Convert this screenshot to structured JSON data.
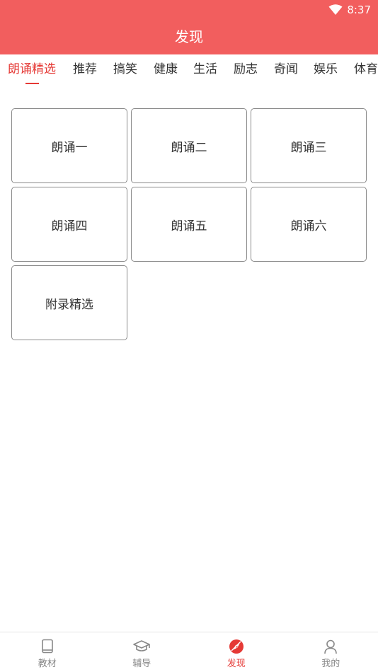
{
  "status_bar": {
    "time": "8:37",
    "wifi_icon": "wifi-icon"
  },
  "header": {
    "title": "发现"
  },
  "tabs": [
    {
      "label": "朗诵精选",
      "active": true
    },
    {
      "label": "推荐"
    },
    {
      "label": "搞笑"
    },
    {
      "label": "健康"
    },
    {
      "label": "生活"
    },
    {
      "label": "励志"
    },
    {
      "label": "奇闻"
    },
    {
      "label": "娱乐"
    },
    {
      "label": "体育"
    }
  ],
  "cards": [
    {
      "label": "朗诵一"
    },
    {
      "label": "朗诵二"
    },
    {
      "label": "朗诵三"
    },
    {
      "label": "朗诵四"
    },
    {
      "label": "朗诵五"
    },
    {
      "label": "朗诵六"
    },
    {
      "label": "附录精选"
    }
  ],
  "bottom_nav": [
    {
      "label": "教材",
      "icon": "book-icon"
    },
    {
      "label": "辅导",
      "icon": "graduation-cap-icon"
    },
    {
      "label": "发现",
      "icon": "compass-icon",
      "active": true
    },
    {
      "label": "我的",
      "icon": "person-icon"
    }
  ],
  "colors": {
    "header": "#f25e5e",
    "accent": "#e53935",
    "text": "#333333",
    "nav_inactive": "#888888"
  }
}
